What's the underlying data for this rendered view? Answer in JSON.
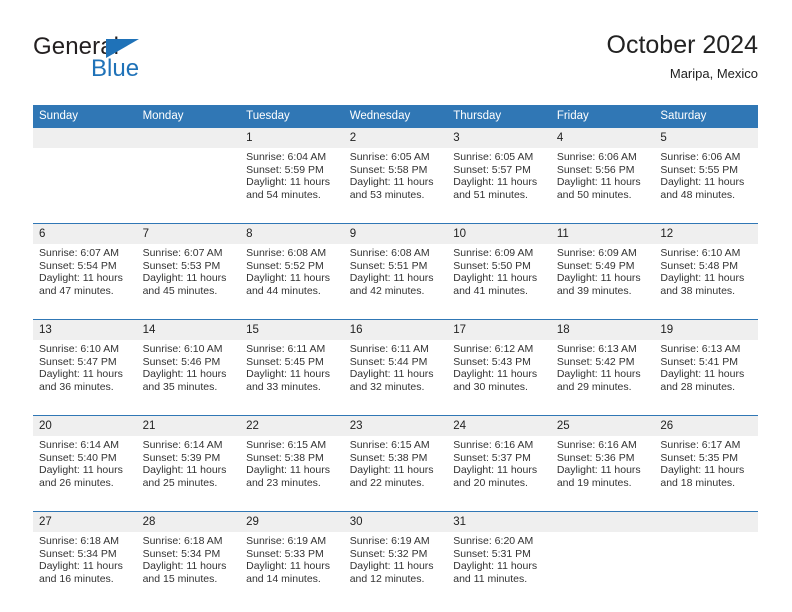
{
  "brand": {
    "name_part1": "General",
    "name_part2": "Blue"
  },
  "header": {
    "title": "October 2024",
    "subtitle": "Maripa, Mexico"
  },
  "colors": {
    "header_blue": "#3077b5",
    "date_band": "#efefef",
    "brand_blue": "#1f72b8",
    "text": "#222222"
  },
  "weekday_headers": [
    "Sunday",
    "Monday",
    "Tuesday",
    "Wednesday",
    "Thursday",
    "Friday",
    "Saturday"
  ],
  "weeks": [
    {
      "days": [
        {
          "date": "",
          "lines": []
        },
        {
          "date": "",
          "lines": []
        },
        {
          "date": "1",
          "lines": [
            "Sunrise: 6:04 AM",
            "Sunset: 5:59 PM",
            "Daylight: 11 hours",
            "and 54 minutes."
          ]
        },
        {
          "date": "2",
          "lines": [
            "Sunrise: 6:05 AM",
            "Sunset: 5:58 PM",
            "Daylight: 11 hours",
            "and 53 minutes."
          ]
        },
        {
          "date": "3",
          "lines": [
            "Sunrise: 6:05 AM",
            "Sunset: 5:57 PM",
            "Daylight: 11 hours",
            "and 51 minutes."
          ]
        },
        {
          "date": "4",
          "lines": [
            "Sunrise: 6:06 AM",
            "Sunset: 5:56 PM",
            "Daylight: 11 hours",
            "and 50 minutes."
          ]
        },
        {
          "date": "5",
          "lines": [
            "Sunrise: 6:06 AM",
            "Sunset: 5:55 PM",
            "Daylight: 11 hours",
            "and 48 minutes."
          ]
        }
      ]
    },
    {
      "days": [
        {
          "date": "6",
          "lines": [
            "Sunrise: 6:07 AM",
            "Sunset: 5:54 PM",
            "Daylight: 11 hours",
            "and 47 minutes."
          ]
        },
        {
          "date": "7",
          "lines": [
            "Sunrise: 6:07 AM",
            "Sunset: 5:53 PM",
            "Daylight: 11 hours",
            "and 45 minutes."
          ]
        },
        {
          "date": "8",
          "lines": [
            "Sunrise: 6:08 AM",
            "Sunset: 5:52 PM",
            "Daylight: 11 hours",
            "and 44 minutes."
          ]
        },
        {
          "date": "9",
          "lines": [
            "Sunrise: 6:08 AM",
            "Sunset: 5:51 PM",
            "Daylight: 11 hours",
            "and 42 minutes."
          ]
        },
        {
          "date": "10",
          "lines": [
            "Sunrise: 6:09 AM",
            "Sunset: 5:50 PM",
            "Daylight: 11 hours",
            "and 41 minutes."
          ]
        },
        {
          "date": "11",
          "lines": [
            "Sunrise: 6:09 AM",
            "Sunset: 5:49 PM",
            "Daylight: 11 hours",
            "and 39 minutes."
          ]
        },
        {
          "date": "12",
          "lines": [
            "Sunrise: 6:10 AM",
            "Sunset: 5:48 PM",
            "Daylight: 11 hours",
            "and 38 minutes."
          ]
        }
      ]
    },
    {
      "days": [
        {
          "date": "13",
          "lines": [
            "Sunrise: 6:10 AM",
            "Sunset: 5:47 PM",
            "Daylight: 11 hours",
            "and 36 minutes."
          ]
        },
        {
          "date": "14",
          "lines": [
            "Sunrise: 6:10 AM",
            "Sunset: 5:46 PM",
            "Daylight: 11 hours",
            "and 35 minutes."
          ]
        },
        {
          "date": "15",
          "lines": [
            "Sunrise: 6:11 AM",
            "Sunset: 5:45 PM",
            "Daylight: 11 hours",
            "and 33 minutes."
          ]
        },
        {
          "date": "16",
          "lines": [
            "Sunrise: 6:11 AM",
            "Sunset: 5:44 PM",
            "Daylight: 11 hours",
            "and 32 minutes."
          ]
        },
        {
          "date": "17",
          "lines": [
            "Sunrise: 6:12 AM",
            "Sunset: 5:43 PM",
            "Daylight: 11 hours",
            "and 30 minutes."
          ]
        },
        {
          "date": "18",
          "lines": [
            "Sunrise: 6:13 AM",
            "Sunset: 5:42 PM",
            "Daylight: 11 hours",
            "and 29 minutes."
          ]
        },
        {
          "date": "19",
          "lines": [
            "Sunrise: 6:13 AM",
            "Sunset: 5:41 PM",
            "Daylight: 11 hours",
            "and 28 minutes."
          ]
        }
      ]
    },
    {
      "days": [
        {
          "date": "20",
          "lines": [
            "Sunrise: 6:14 AM",
            "Sunset: 5:40 PM",
            "Daylight: 11 hours",
            "and 26 minutes."
          ]
        },
        {
          "date": "21",
          "lines": [
            "Sunrise: 6:14 AM",
            "Sunset: 5:39 PM",
            "Daylight: 11 hours",
            "and 25 minutes."
          ]
        },
        {
          "date": "22",
          "lines": [
            "Sunrise: 6:15 AM",
            "Sunset: 5:38 PM",
            "Daylight: 11 hours",
            "and 23 minutes."
          ]
        },
        {
          "date": "23",
          "lines": [
            "Sunrise: 6:15 AM",
            "Sunset: 5:38 PM",
            "Daylight: 11 hours",
            "and 22 minutes."
          ]
        },
        {
          "date": "24",
          "lines": [
            "Sunrise: 6:16 AM",
            "Sunset: 5:37 PM",
            "Daylight: 11 hours",
            "and 20 minutes."
          ]
        },
        {
          "date": "25",
          "lines": [
            "Sunrise: 6:16 AM",
            "Sunset: 5:36 PM",
            "Daylight: 11 hours",
            "and 19 minutes."
          ]
        },
        {
          "date": "26",
          "lines": [
            "Sunrise: 6:17 AM",
            "Sunset: 5:35 PM",
            "Daylight: 11 hours",
            "and 18 minutes."
          ]
        }
      ]
    },
    {
      "days": [
        {
          "date": "27",
          "lines": [
            "Sunrise: 6:18 AM",
            "Sunset: 5:34 PM",
            "Daylight: 11 hours",
            "and 16 minutes."
          ]
        },
        {
          "date": "28",
          "lines": [
            "Sunrise: 6:18 AM",
            "Sunset: 5:34 PM",
            "Daylight: 11 hours",
            "and 15 minutes."
          ]
        },
        {
          "date": "29",
          "lines": [
            "Sunrise: 6:19 AM",
            "Sunset: 5:33 PM",
            "Daylight: 11 hours",
            "and 14 minutes."
          ]
        },
        {
          "date": "30",
          "lines": [
            "Sunrise: 6:19 AM",
            "Sunset: 5:32 PM",
            "Daylight: 11 hours",
            "and 12 minutes."
          ]
        },
        {
          "date": "31",
          "lines": [
            "Sunrise: 6:20 AM",
            "Sunset: 5:31 PM",
            "Daylight: 11 hours",
            "and 11 minutes."
          ]
        },
        {
          "date": "",
          "lines": []
        },
        {
          "date": "",
          "lines": []
        }
      ]
    }
  ]
}
